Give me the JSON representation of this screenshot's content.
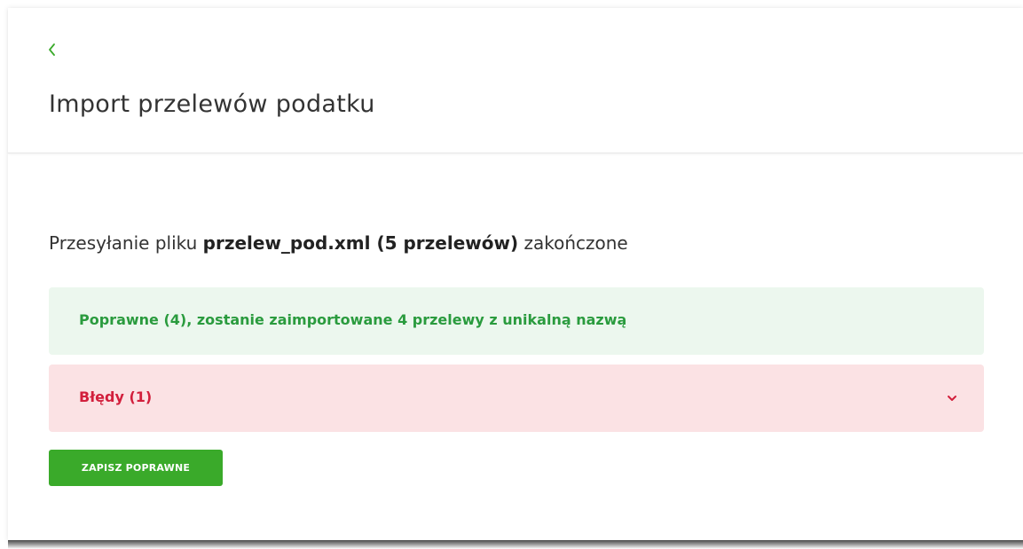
{
  "header": {
    "back_icon": "chevron-left-icon",
    "title": "Import przelewów podatku"
  },
  "upload": {
    "prefix": "Przesyłanie pliku",
    "file_info": "przelew_pod.xml (5 przelewów)",
    "suffix": "zakończone"
  },
  "panels": {
    "success": {
      "text": "Poprawne (4), zostanie zaimportowane 4 przelewy z unikalną nazwą"
    },
    "error": {
      "text": "Błędy (1)",
      "icon": "chevron-down-icon"
    }
  },
  "actions": {
    "save_label": "ZAPISZ POPRAWNE"
  },
  "colors": {
    "accent_green": "#3aaa2a",
    "success_bg": "#ecf7ee",
    "success_text": "#2a9b3e",
    "error_bg": "#fbe2e4",
    "error_text": "#d21f3c",
    "title_text": "#333333"
  }
}
